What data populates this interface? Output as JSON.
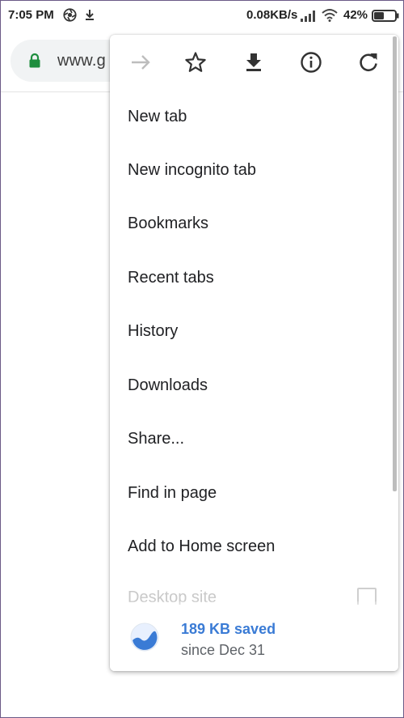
{
  "status_bar": {
    "time": "7:05 PM",
    "network_speed": "0.08KB/s",
    "battery_percent": "42%",
    "icons": [
      "aperture-icon",
      "download-notification-icon",
      "signal-icon",
      "wifi-icon",
      "battery-icon"
    ]
  },
  "address_bar": {
    "url_partial": "www.g",
    "lock_color": "#1e8e3e"
  },
  "menu": {
    "icon_row": [
      {
        "name": "forward-icon",
        "enabled": false
      },
      {
        "name": "bookmark-star-icon",
        "enabled": true
      },
      {
        "name": "download-icon",
        "enabled": true
      },
      {
        "name": "info-icon",
        "enabled": true
      },
      {
        "name": "refresh-icon",
        "enabled": true
      }
    ],
    "items": [
      {
        "label": "New tab"
      },
      {
        "label": "New incognito tab"
      },
      {
        "label": "Bookmarks"
      },
      {
        "label": "Recent tabs"
      },
      {
        "label": "History"
      },
      {
        "label": "Downloads"
      },
      {
        "label": "Share..."
      },
      {
        "label": "Find in page"
      },
      {
        "label": "Add to Home screen"
      },
      {
        "label": "Desktop site",
        "checked": false
      }
    ],
    "data_saver": {
      "amount": "189 KB saved",
      "since": "since Dec 31",
      "accent": "#3a7bd5"
    }
  }
}
